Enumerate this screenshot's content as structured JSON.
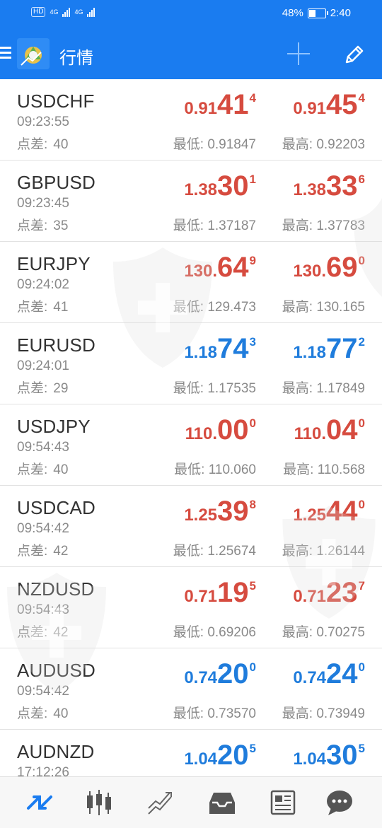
{
  "status_bar": {
    "left_tags": [
      "HD",
      "4G",
      "4G"
    ],
    "battery_text": "48%",
    "battery_level": 0.48,
    "time": "2:40"
  },
  "app_bar": {
    "title": "行情",
    "icons": [
      "menu-icon",
      "app-logo",
      "add-icon",
      "edit-icon"
    ]
  },
  "labels": {
    "spread": "点差:",
    "low": "最低:",
    "high": "最高:"
  },
  "colors": {
    "header_blue": "#1a7cf0",
    "price_red": "#d64b3f",
    "price_blue": "#1f7cdc"
  },
  "quotes": [
    {
      "symbol": "USDCHF",
      "time": "09:23:55",
      "spread": "40",
      "color": "red",
      "bid": {
        "small": "0.91",
        "big": "41",
        "sup": "4"
      },
      "ask": {
        "small": "0.91",
        "big": "45",
        "sup": "4"
      },
      "low": "0.91847",
      "high": "0.92203"
    },
    {
      "symbol": "GBPUSD",
      "time": "09:23:45",
      "spread": "35",
      "color": "red",
      "bid": {
        "small": "1.38",
        "big": "30",
        "sup": "1"
      },
      "ask": {
        "small": "1.38",
        "big": "33",
        "sup": "6"
      },
      "low": "1.37187",
      "high": "1.37783"
    },
    {
      "symbol": "EURJPY",
      "time": "09:24:02",
      "spread": "41",
      "color": "red",
      "bid": {
        "small": "130.",
        "big": "64",
        "sup": "9"
      },
      "ask": {
        "small": "130.",
        "big": "69",
        "sup": "0"
      },
      "low": "129.473",
      "high": "130.165"
    },
    {
      "symbol": "EURUSD",
      "time": "09:24:01",
      "spread": "29",
      "color": "blue",
      "bid": {
        "small": "1.18",
        "big": "74",
        "sup": "3"
      },
      "ask": {
        "small": "1.18",
        "big": "77",
        "sup": "2"
      },
      "low": "1.17535",
      "high": "1.17849"
    },
    {
      "symbol": "USDJPY",
      "time": "09:54:43",
      "spread": "40",
      "color": "red",
      "bid": {
        "small": "110.",
        "big": "00",
        "sup": "0"
      },
      "ask": {
        "small": "110.",
        "big": "04",
        "sup": "0"
      },
      "low": "110.060",
      "high": "110.568"
    },
    {
      "symbol": "USDCAD",
      "time": "09:54:42",
      "spread": "42",
      "color": "red",
      "bid": {
        "small": "1.25",
        "big": "39",
        "sup": "8"
      },
      "ask": {
        "small": "1.25",
        "big": "44",
        "sup": "0"
      },
      "low": "1.25674",
      "high": "1.26144"
    },
    {
      "symbol": "NZDUSD",
      "time": "09:54:43",
      "spread": "42",
      "color": "red",
      "bid": {
        "small": "0.71",
        "big": "19",
        "sup": "5"
      },
      "ask": {
        "small": "0.71",
        "big": "23",
        "sup": "7"
      },
      "low": "0.69206",
      "high": "0.70275"
    },
    {
      "symbol": "AUDUSD",
      "time": "09:54:42",
      "spread": "40",
      "color": "blue",
      "bid": {
        "small": "0.74",
        "big": "20",
        "sup": "0"
      },
      "ask": {
        "small": "0.74",
        "big": "24",
        "sup": "0"
      },
      "low": "0.73570",
      "high": "0.73949"
    },
    {
      "symbol": "AUDNZD",
      "time": "17:12:26",
      "spread": "",
      "color": "blue",
      "bid": {
        "small": "1.04",
        "big": "20",
        "sup": "5"
      },
      "ask": {
        "small": "1.04",
        "big": "30",
        "sup": "5"
      },
      "low": "",
      "high": ""
    }
  ],
  "bottom_nav": [
    {
      "icon": "quotes-icon",
      "active": true
    },
    {
      "icon": "chart-icon",
      "active": false
    },
    {
      "icon": "trade-icon",
      "active": false
    },
    {
      "icon": "history-icon",
      "active": false
    },
    {
      "icon": "news-icon",
      "active": false
    },
    {
      "icon": "chat-icon",
      "active": false
    }
  ]
}
